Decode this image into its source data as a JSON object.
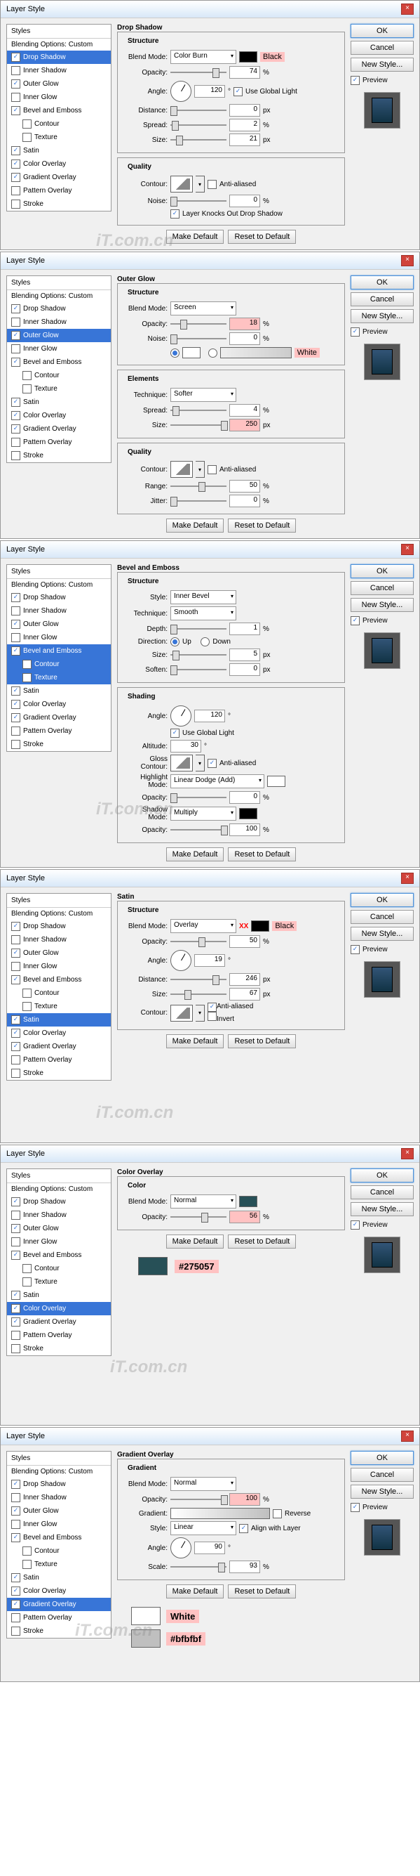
{
  "title": "Layer Style",
  "styles_header": "Styles",
  "blending": "Blending Options: Custom",
  "style_items": [
    "Drop Shadow",
    "Inner Shadow",
    "Outer Glow",
    "Inner Glow",
    "Bevel and Emboss",
    "Contour",
    "Texture",
    "Satin",
    "Color Overlay",
    "Gradient Overlay",
    "Pattern Overlay",
    "Stroke"
  ],
  "right": {
    "ok": "OK",
    "cancel": "Cancel",
    "new_style": "New Style...",
    "preview": "Preview"
  },
  "btns": {
    "make_default": "Make Default",
    "reset_default": "Reset to Default"
  },
  "labels": {
    "structure": "Structure",
    "quality": "Quality",
    "elements": "Elements",
    "shading": "Shading",
    "gradient": "Gradient",
    "blend_mode": "Blend Mode:",
    "opacity": "Opacity:",
    "angle": "Angle:",
    "distance": "Distance:",
    "spread": "Spread:",
    "size": "Size:",
    "noise": "Noise:",
    "technique": "Technique:",
    "range": "Range:",
    "jitter": "Jitter:",
    "contour": "Contour:",
    "use_global": "Use Global Light",
    "anti": "Anti-aliased",
    "knockout": "Layer Knocks Out Drop Shadow",
    "style": "Style:",
    "depth": "Depth:",
    "direction": "Direction:",
    "up": "Up",
    "down": "Down",
    "soften": "Soften:",
    "altitude": "Altitude:",
    "gloss": "Gloss Contour:",
    "highlight": "Highlight Mode:",
    "shadow": "Shadow Mode:",
    "invert": "Invert",
    "gradient_lbl": "Gradient:",
    "reverse": "Reverse",
    "align": "Align with Layer",
    "scale": "Scale:"
  },
  "panels": {
    "drop_shadow": {
      "title": "Drop Shadow",
      "blend": "Color Burn",
      "color_note": "Black",
      "opacity": "74",
      "angle": "120",
      "distance": "0",
      "spread": "2",
      "size": "21"
    },
    "outer_glow": {
      "title": "Outer Glow",
      "blend": "Screen",
      "opacity": "18",
      "noise": "0",
      "color_note": "White",
      "technique": "Softer",
      "spread": "4",
      "size": "250",
      "range": "50",
      "jitter": "0"
    },
    "bevel": {
      "title": "Bevel and Emboss",
      "style": "Inner Bevel",
      "technique": "Smooth",
      "depth": "1",
      "size": "5",
      "soften": "0",
      "angle": "120",
      "altitude": "30",
      "highlight": "Linear Dodge (Add)",
      "h_opacity": "0",
      "shadow": "Multiply",
      "s_opacity": "100"
    },
    "satin": {
      "title": "Satin",
      "blend": "Overlay",
      "note": "XX",
      "color_note": "Black",
      "opacity": "50",
      "angle": "19",
      "distance": "246",
      "size": "67"
    },
    "color_overlay": {
      "title": "Color Overlay",
      "blend": "Normal",
      "opacity": "56",
      "hex": "#275057"
    },
    "gradient_overlay": {
      "title": "Gradient Overlay",
      "blend": "Normal",
      "opacity": "100",
      "style": "Linear",
      "angle": "90",
      "scale": "93",
      "note1": "White",
      "note2": "#bfbfbf"
    }
  }
}
